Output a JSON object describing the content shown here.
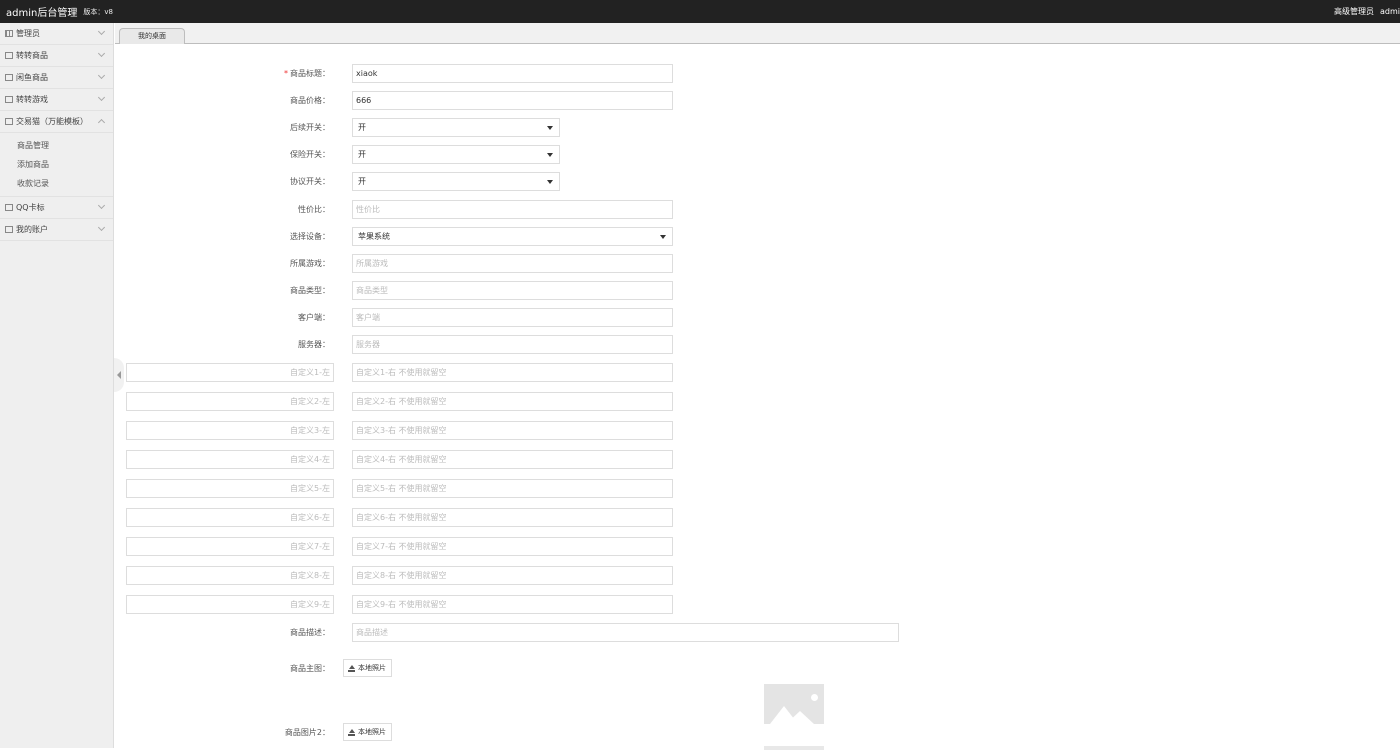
{
  "topbar": {
    "brand": "admin后台管理",
    "version": "版本：v8",
    "role": "高级管理员",
    "user": "admi"
  },
  "sidebar": {
    "items": [
      {
        "label": "管理员",
        "icon": "grid-icon",
        "expanded": false
      },
      {
        "label": "转转商品",
        "icon": "lock-icon",
        "expanded": false
      },
      {
        "label": "闲鱼商品",
        "icon": "lock-icon",
        "expanded": false
      },
      {
        "label": "转转游戏",
        "icon": "lock-icon",
        "expanded": false
      },
      {
        "label": "交易猫（万能模板）",
        "icon": "lock-icon",
        "expanded": true,
        "children": [
          "商品管理",
          "添加商品",
          "收款记录"
        ]
      },
      {
        "label": "QQ卡标",
        "icon": "lock-icon",
        "expanded": false
      },
      {
        "label": "我的账户",
        "icon": "lock-icon",
        "expanded": false
      }
    ]
  },
  "tabs": [
    {
      "label": "我的桌面"
    }
  ],
  "form": {
    "title_label": "商品标题：",
    "title_value": "xiaok",
    "price_label": "商品价格：",
    "price_value": "666",
    "followup_label": "后续开关：",
    "followup_value": "开",
    "insurance_label": "保险开关：",
    "insurance_value": "开",
    "agreement_label": "协议开关：",
    "agreement_value": "开",
    "ratio_label": "性价比：",
    "ratio_placeholder": "性价比",
    "device_label": "选择设备：",
    "device_value": "苹果系统",
    "game_label": "所属游戏：",
    "game_placeholder": "所属游戏",
    "type_label": "商品类型：",
    "type_placeholder": "商品类型",
    "client_label": "客户端：",
    "client_placeholder": "客户端",
    "server_label": "服务器：",
    "server_placeholder": "服务器",
    "custom": [
      {
        "left": "自定义1-左",
        "right": "自定义1-右 不使用就留空"
      },
      {
        "left": "自定义2-左",
        "right": "自定义2-右 不使用就留空"
      },
      {
        "left": "自定义3-左",
        "right": "自定义3-右 不使用就留空"
      },
      {
        "left": "自定义4-左",
        "right": "自定义4-右 不使用就留空"
      },
      {
        "left": "自定义5-左",
        "right": "自定义5-右 不使用就留空"
      },
      {
        "left": "自定义6-左",
        "right": "自定义6-右 不使用就留空"
      },
      {
        "left": "自定义7-左",
        "right": "自定义7-右 不使用就留空"
      },
      {
        "left": "自定义8-左",
        "right": "自定义8-右 不使用就留空"
      },
      {
        "left": "自定义9-左",
        "right": "自定义9-右 不使用就留空"
      }
    ],
    "desc_label": "商品描述：",
    "desc_placeholder": "商品描述",
    "main_image_label": "商品主图：",
    "image2_label": "商品图片2：",
    "upload_label": "本地照片"
  }
}
